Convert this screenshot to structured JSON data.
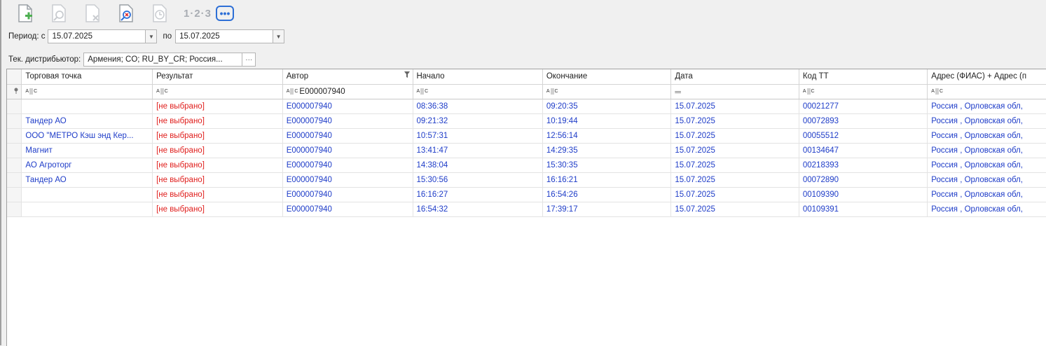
{
  "toolbar": {
    "buttons": [
      "add",
      "view",
      "delete",
      "find-cancel",
      "history"
    ],
    "numbering_label": "1·2·3",
    "more_label": "•••"
  },
  "period": {
    "from_label": "Период: с",
    "from_value": "15.07.2025",
    "to_label": "по",
    "to_value": "15.07.2025"
  },
  "distributor": {
    "label": "Тек. дистрибьютор:",
    "value": "Армения; CO; RU_BY_CR; Россия...",
    "more": "···"
  },
  "grid": {
    "columns": [
      "Торговая точка",
      "Результат",
      "Автор",
      "Начало",
      "Окончание",
      "Дата",
      "Код ТТ",
      "Адрес (ФИАС) + Адрес (п"
    ],
    "filters": [
      "",
      "",
      "E000007940",
      "",
      "",
      "",
      "",
      ""
    ],
    "rows": [
      [
        "",
        "[не выбрано]",
        "E000007940",
        "08:36:38",
        "09:20:35",
        "15.07.2025",
        "00021277",
        "Россия , Орловская обл,"
      ],
      [
        "Тандер АО",
        "[не выбрано]",
        "E000007940",
        "09:21:32",
        "10:19:44",
        "15.07.2025",
        "00072893",
        "Россия , Орловская обл,"
      ],
      [
        "ООО \"МЕТРО Кэш энд Кер...",
        "[не выбрано]",
        "E000007940",
        "10:57:31",
        "12:56:14",
        "15.07.2025",
        "00055512",
        "Россия , Орловская обл,"
      ],
      [
        "Магнит",
        "[не выбрано]",
        "E000007940",
        "13:41:47",
        "14:29:35",
        "15.07.2025",
        "00134647",
        "Россия , Орловская обл,"
      ],
      [
        "АО Агроторг",
        "[не выбрано]",
        "E000007940",
        "14:38:04",
        "15:30:35",
        "15.07.2025",
        "00218393",
        "Россия , Орловская обл,"
      ],
      [
        "Тандер АО",
        "[не выбрано]",
        "E000007940",
        "15:30:56",
        "16:16:21",
        "15.07.2025",
        "00072890",
        "Россия , Орловская обл,"
      ],
      [
        "",
        "[не выбрано]",
        "E000007940",
        "16:16:27",
        "16:54:26",
        "15.07.2025",
        "00109390",
        "Россия , Орловская обл,"
      ],
      [
        "",
        "[не выбрано]",
        "E000007940",
        "16:54:32",
        "17:39:17",
        "15.07.2025",
        "00109391",
        "Россия , Орловская обл,"
      ]
    ]
  },
  "colors": {
    "link": "#1e3cc8",
    "unselected": "#e0201e",
    "accent": "#2d6fd6"
  }
}
